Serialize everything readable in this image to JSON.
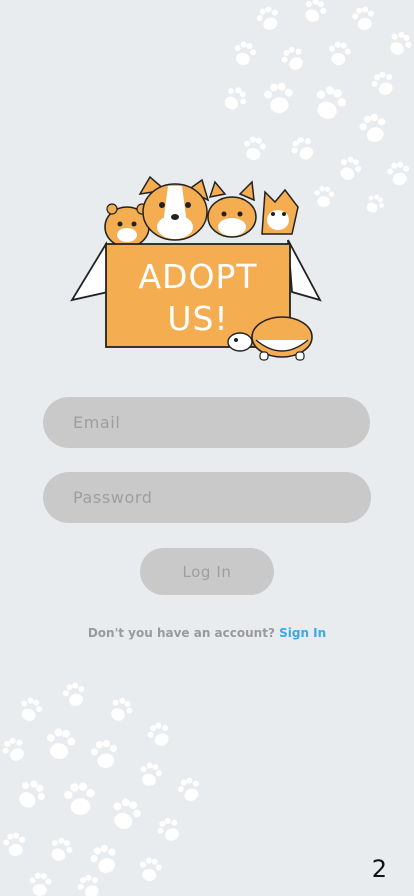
{
  "illustration": {
    "box_text_line1": "ADOPT",
    "box_text_line2": "US!",
    "box_color": "#f5ad52"
  },
  "form": {
    "email_placeholder": "Email",
    "password_placeholder": "Password",
    "login_label": "Log In"
  },
  "footer": {
    "prompt": "Don't you have an account?",
    "link": "Sign In",
    "link_color": "#3aa8ea"
  },
  "page_number": "2",
  "icons": [
    "paw-pattern-icon",
    "paw-pattern-icon"
  ]
}
